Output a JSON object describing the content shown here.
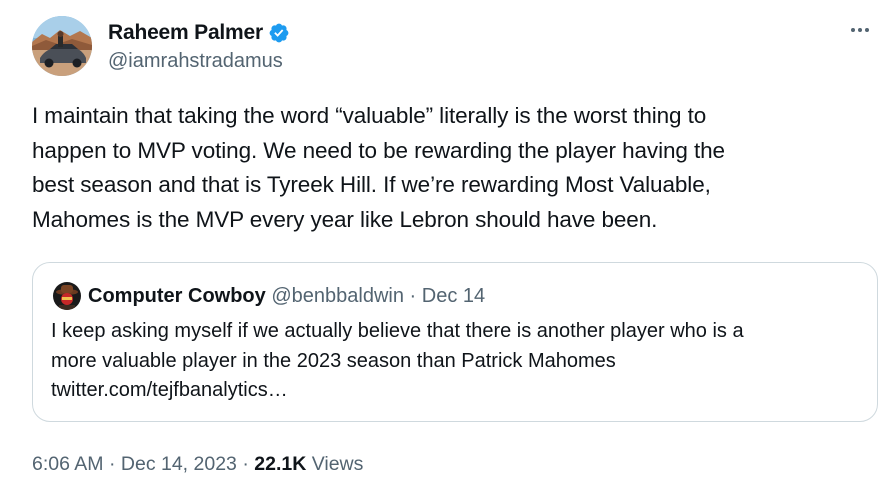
{
  "author": {
    "display_name": "Raheem Palmer",
    "handle": "@iamrahstradamus",
    "avatar_icon": "avatar-photo-icon",
    "verified_icon": "verified-badge-icon",
    "verified_color": "#1d9bf0"
  },
  "more_icon": "more-options-icon",
  "tweet": {
    "lines": [
      "I maintain that taking the word “valuable” literally is the worst thing to",
      "happen to MVP voting. We need to be rewarding the player having the",
      "best season and that is Tyreek Hill. If we’re rewarding Most Valuable,",
      "Mahomes is the MVP every year like Lebron should have been."
    ]
  },
  "quoted": {
    "display_name": "Computer Cowboy",
    "handle": "@benbbaldwin",
    "separator": "·",
    "date": "Dec 14",
    "avatar_icon": "quoted-avatar-icon",
    "lines": [
      "I keep asking myself if we actually believe that there is another player who is a",
      "more valuable player in the 2023 season than Patrick Mahomes",
      "twitter.com/tejfbanalytics…"
    ]
  },
  "footer": {
    "time": "6:06 AM",
    "sep1": "·",
    "date": "Dec 14, 2023",
    "sep2": "·",
    "views_count": "22.1K",
    "views_label": "Views"
  }
}
